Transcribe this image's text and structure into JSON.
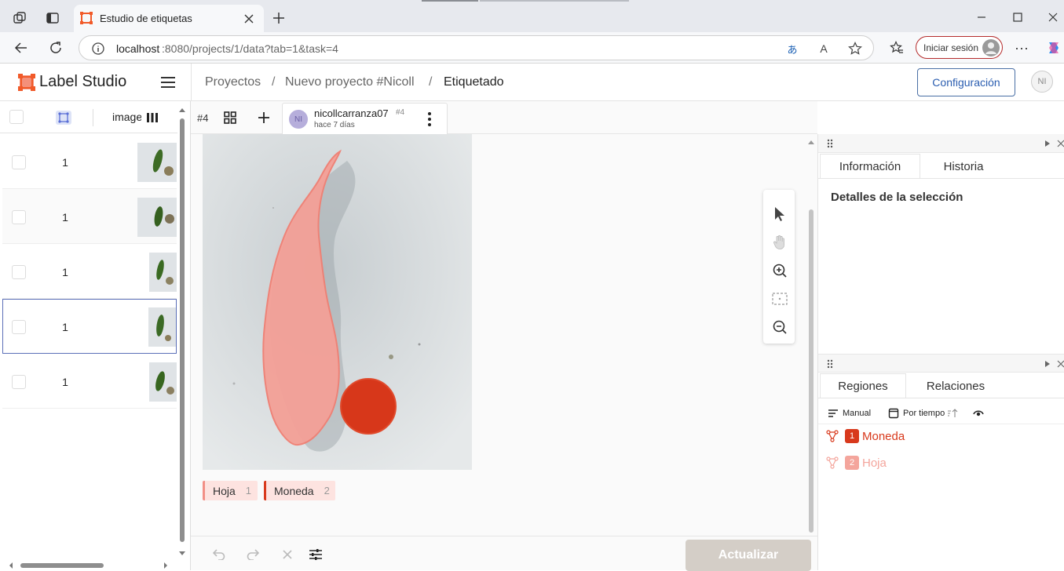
{
  "browser": {
    "tab_title": "Estudio de etiquetas",
    "url_host": "localhost",
    "url_rest": ":8080/projects/1/data?tab=1&task=4",
    "sign_in_label": "Iniciar sesión"
  },
  "app": {
    "logo_text": "Label Studio",
    "breadcrumbs": [
      "Proyectos",
      "Nuevo proyecto #Nicoll",
      "Etiquetado"
    ],
    "settings_label": "Configuración",
    "avatar_initials": "NI"
  },
  "task_list": {
    "column_header": "image",
    "rows": [
      {
        "id": "1"
      },
      {
        "id": "1"
      },
      {
        "id": "1"
      },
      {
        "id": "1"
      },
      {
        "id": "1"
      }
    ]
  },
  "annotation": {
    "task_number": "#4",
    "user_initials": "NI",
    "username": "nicollcarranza07",
    "annotation_id": "#4",
    "time_ago": "hace 7 días",
    "labels": [
      {
        "name": "Hoja",
        "hotkey": "1",
        "color": "#f28f86"
      },
      {
        "name": "Moneda",
        "hotkey": "2",
        "color": "#d8391c"
      }
    ],
    "update_button": "Actualizar"
  },
  "right_panel": {
    "tabs_top": [
      "Información",
      "Historia"
    ],
    "selection_title": "Detalles de la selección",
    "tabs_bottom": [
      "Regiones",
      "Relaciones"
    ],
    "sort_manual": "Manual",
    "sort_time": "Por tiempo",
    "regions": [
      {
        "num": "1",
        "label": "Moneda",
        "color": "#d8391c"
      },
      {
        "num": "2",
        "label": "Hoja",
        "color": "#f4a59c"
      }
    ]
  }
}
